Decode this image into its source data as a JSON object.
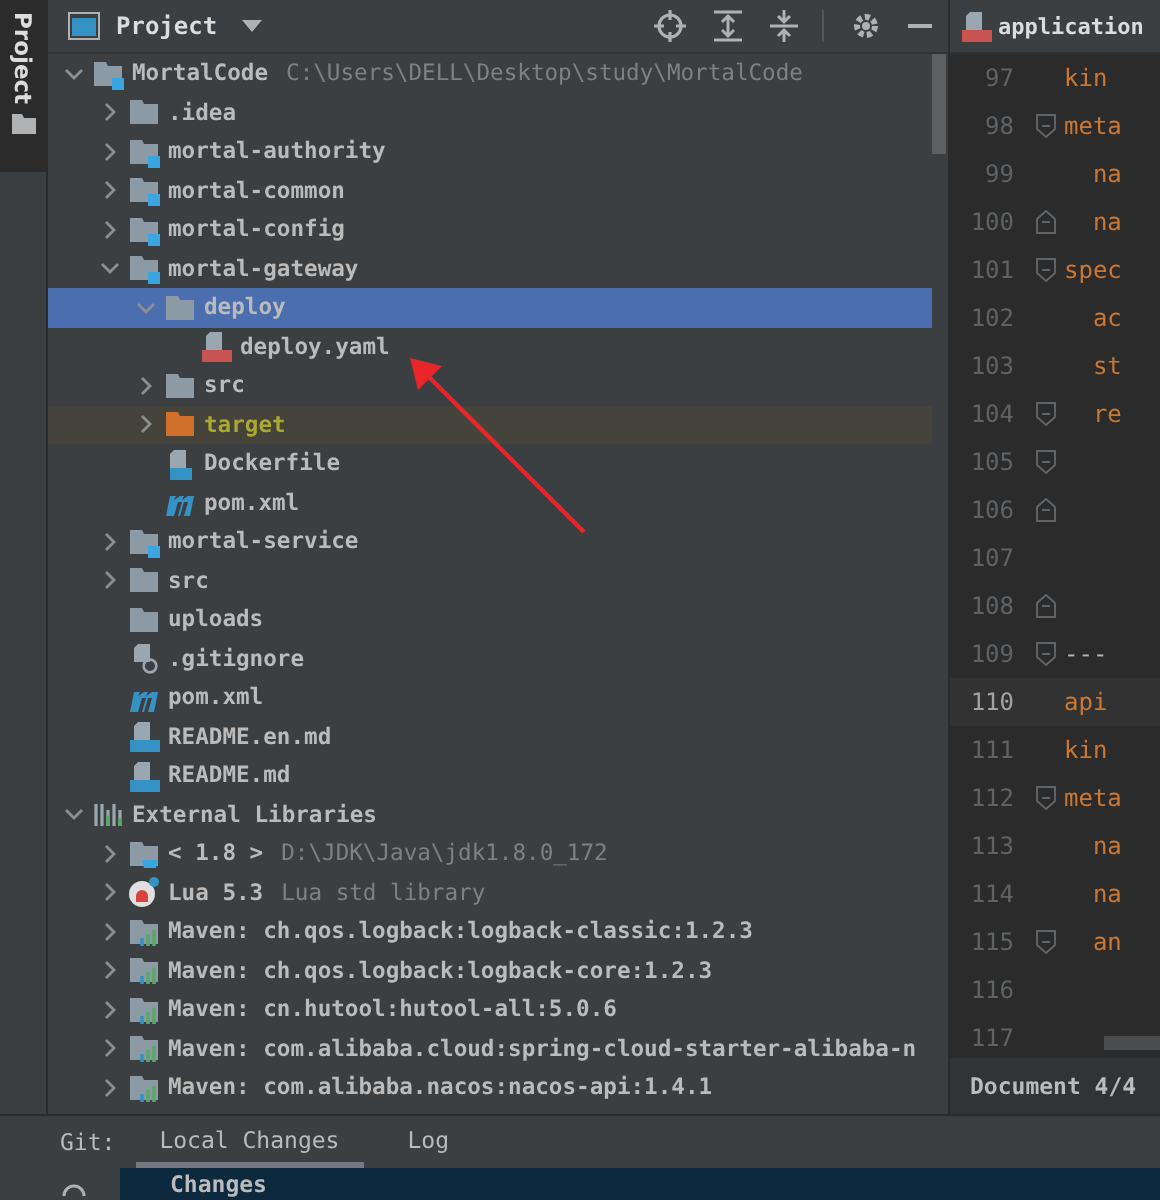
{
  "side_strip": {
    "label": "Project"
  },
  "project_panel": {
    "title": "Project"
  },
  "tree": [
    {
      "label": "MortalCode",
      "hint": "C:\\Users\\DELL\\Desktop\\study\\MortalCode",
      "kind": "module",
      "expanded": true,
      "selected": false,
      "children": [
        {
          "label": ".idea",
          "kind": "folder",
          "expanded": false,
          "selected": false
        },
        {
          "label": "mortal-authority",
          "kind": "module",
          "expanded": false,
          "selected": false
        },
        {
          "label": "mortal-common",
          "kind": "module",
          "expanded": false,
          "selected": false
        },
        {
          "label": "mortal-config",
          "kind": "module",
          "expanded": false,
          "selected": false
        },
        {
          "label": "mortal-gateway",
          "kind": "module",
          "expanded": true,
          "selected": false,
          "children": [
            {
              "label": "deploy",
              "kind": "folder",
              "expanded": true,
              "selected": true,
              "children": [
                {
                  "label": "deploy.yaml",
                  "kind": "yaml",
                  "selected": false
                }
              ]
            },
            {
              "label": "src",
              "kind": "folder",
              "expanded": false,
              "selected": false
            },
            {
              "label": "target",
              "kind": "excluded",
              "expanded": false,
              "selected": false
            },
            {
              "label": "Dockerfile",
              "kind": "docker",
              "selected": false
            },
            {
              "label": "pom.xml",
              "kind": "maven",
              "selected": false
            }
          ]
        },
        {
          "label": "mortal-service",
          "kind": "module",
          "expanded": false,
          "selected": false
        },
        {
          "label": "src",
          "kind": "folder",
          "expanded": false,
          "selected": false
        },
        {
          "label": "uploads",
          "kind": "folder",
          "selected": false
        },
        {
          "label": ".gitignore",
          "kind": "ignore",
          "selected": false
        },
        {
          "label": "pom.xml",
          "kind": "maven",
          "selected": false
        },
        {
          "label": "README.en.md",
          "kind": "markdown",
          "selected": false
        },
        {
          "label": "README.md",
          "kind": "markdown",
          "selected": false
        }
      ]
    },
    {
      "label": "External Libraries",
      "kind": "libraries",
      "expanded": true,
      "selected": false,
      "children": [
        {
          "label": "< 1.8 >",
          "hint": "D:\\JDK\\Java\\jdk1.8.0_172",
          "kind": "jdk",
          "expanded": false,
          "selected": false
        },
        {
          "label": "Lua 5.3",
          "hint": "Lua std library",
          "kind": "lua",
          "expanded": false,
          "selected": false
        },
        {
          "label": "Maven: ch.qos.logback:logback-classic:1.2.3",
          "kind": "library",
          "expanded": false,
          "selected": false
        },
        {
          "label": "Maven: ch.qos.logback:logback-core:1.2.3",
          "kind": "library",
          "expanded": false,
          "selected": false
        },
        {
          "label": "Maven: cn.hutool:hutool-all:5.0.6",
          "kind": "library",
          "expanded": false,
          "selected": false
        },
        {
          "label": "Maven: com.alibaba.cloud:spring-cloud-starter-alibaba-n",
          "kind": "library",
          "expanded": false,
          "selected": false
        },
        {
          "label": "Maven: com.alibaba.nacos:nacos-api:1.4.1",
          "kind": "library",
          "expanded": false,
          "selected": false
        }
      ]
    }
  ],
  "editor": {
    "tab": "application",
    "lines": [
      {
        "number": "97",
        "text": "kin",
        "kind": "key",
        "fold_start": false,
        "fold_end": false,
        "current": false
      },
      {
        "number": "98",
        "text": "meta",
        "kind": "key",
        "fold_start": true,
        "fold_end": false,
        "current": false
      },
      {
        "number": "99",
        "text": "  na",
        "kind": "key",
        "fold_start": false,
        "fold_end": false,
        "current": false
      },
      {
        "number": "100",
        "text": "  na",
        "kind": "key",
        "fold_start": false,
        "fold_end": true,
        "current": false
      },
      {
        "number": "101",
        "text": "spec",
        "kind": "key",
        "fold_start": true,
        "fold_end": false,
        "current": false
      },
      {
        "number": "102",
        "text": "  ac",
        "kind": "key",
        "fold_start": false,
        "fold_end": false,
        "current": false
      },
      {
        "number": "103",
        "text": "  st",
        "kind": "key",
        "fold_start": false,
        "fold_end": false,
        "current": false
      },
      {
        "number": "104",
        "text": "  re",
        "kind": "key",
        "fold_start": true,
        "fold_end": false,
        "current": false
      },
      {
        "number": "105",
        "fold_start": true,
        "fold_end": false,
        "current": false
      },
      {
        "number": "106",
        "fold_start": false,
        "fold_end": true,
        "current": false
      },
      {
        "number": "107",
        "fold_start": false,
        "fold_end": false,
        "current": false
      },
      {
        "number": "108",
        "fold_start": false,
        "fold_end": true,
        "current": false
      },
      {
        "number": "109",
        "text": "---",
        "kind": "separator",
        "fold_start": true,
        "fold_end": false,
        "current": false
      },
      {
        "number": "110",
        "text": "api",
        "kind": "key",
        "fold_start": false,
        "fold_end": false,
        "current": true
      },
      {
        "number": "111",
        "text": "kin",
        "kind": "key",
        "fold_start": false,
        "fold_end": false,
        "current": false
      },
      {
        "number": "112",
        "text": "meta",
        "kind": "key",
        "fold_start": true,
        "fold_end": false,
        "current": false
      },
      {
        "number": "113",
        "text": "  na",
        "kind": "key",
        "fold_start": false,
        "fold_end": false,
        "current": false
      },
      {
        "number": "114",
        "text": "  na",
        "kind": "key",
        "fold_start": false,
        "fold_end": false,
        "current": false
      },
      {
        "number": "115",
        "text": "  an",
        "kind": "key",
        "fold_start": true,
        "fold_end": false,
        "current": false
      },
      {
        "number": "116",
        "fold_start": false,
        "fold_end": false,
        "current": false
      },
      {
        "number": "117",
        "fold_start": false,
        "fold_end": false,
        "current": false
      }
    ],
    "status": "Document 4/4"
  },
  "bottom_panel": {
    "title": "Git:",
    "tabs": [
      {
        "label": "Local Changes",
        "selected": true
      },
      {
        "label": "Log",
        "selected": false
      }
    ],
    "row": "Changes"
  }
}
